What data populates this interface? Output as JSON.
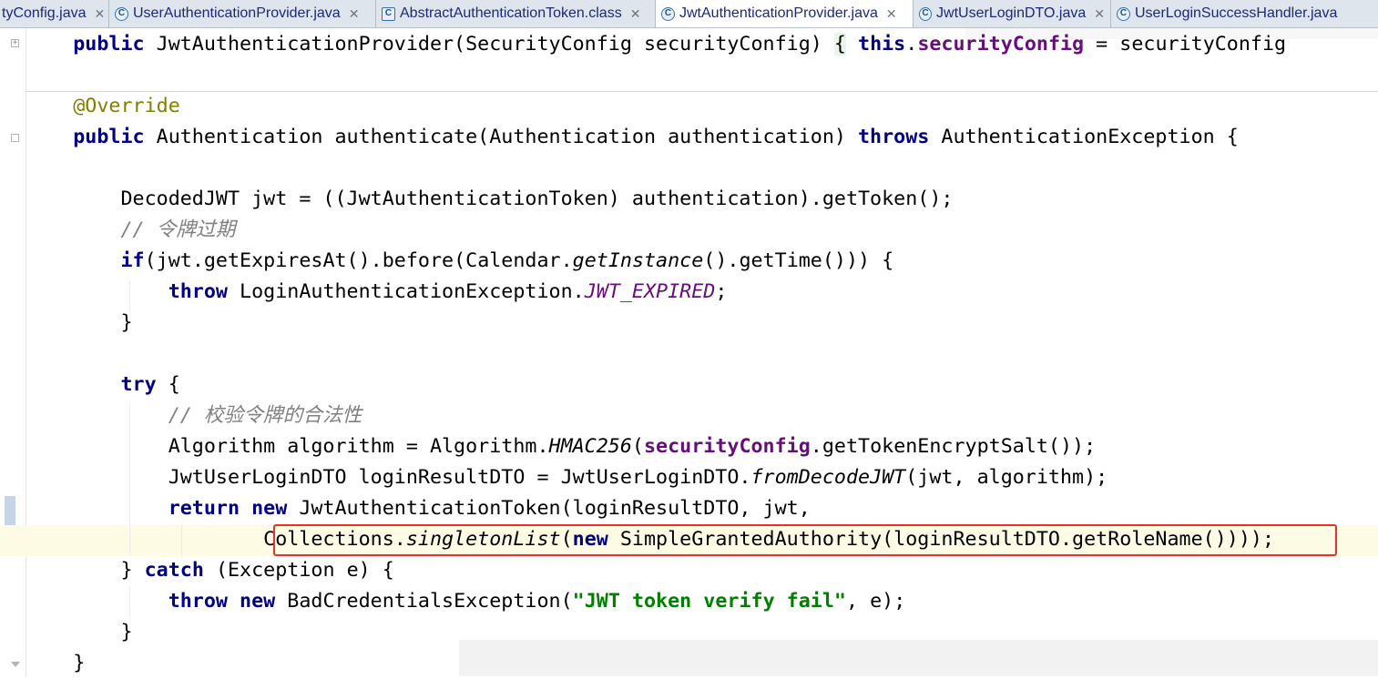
{
  "tabs": [
    {
      "label": "tyConfig.java",
      "icon": "class-file-icon",
      "active": false,
      "closable": true
    },
    {
      "label": "UserAuthenticationProvider.java",
      "icon": "class-file-icon",
      "active": false,
      "closable": true
    },
    {
      "label": "AbstractAuthenticationToken.class",
      "icon": "compiled-class-icon",
      "active": false,
      "closable": true
    },
    {
      "label": "JwtAuthenticationProvider.java",
      "icon": "class-file-icon",
      "active": true,
      "closable": true
    },
    {
      "label": "JwtUserLoginDTO.java",
      "icon": "class-file-icon",
      "active": false,
      "closable": true
    },
    {
      "label": "UserLoginSuccessHandler.java",
      "icon": "class-file-icon",
      "active": false,
      "closable": false
    }
  ],
  "code": {
    "l1": {
      "t1": "public",
      "t2": " JwtAuthenticationProvider(SecurityConfig securityConfig) ",
      "t3": "{",
      "t4": " ",
      "t5": "this",
      "t6": ".",
      "t7": "securityConfig",
      "t8": " = securityConfig"
    },
    "l2": {
      "t1": "@Override"
    },
    "l3": {
      "t1": "public",
      "t2": " Authentication authenticate(Authentication authentication) ",
      "t3": "throws",
      "t4": " AuthenticationException {"
    },
    "l4": {
      "t1": "DecodedJWT jwt = ((JwtAuthenticationToken) authentication).getToken();"
    },
    "l5": {
      "t1": "// 令牌过期"
    },
    "l6": {
      "t1": "if",
      "t2": "(jwt.getExpiresAt().before(Calendar.",
      "t3": "getInstance",
      "t4": "().getTime())) {"
    },
    "l7": {
      "t1": "throw",
      "t2": " LoginAuthenticationException.",
      "t3": "JWT_EXPIRED",
      "t4": ";"
    },
    "l8": {
      "t1": "}"
    },
    "l9": {
      "t1": "try",
      "t2": " {"
    },
    "l10": {
      "t1": "// 校验令牌的合法性"
    },
    "l11": {
      "t1": "Algorithm algorithm = Algorithm.",
      "t2": "HMAC256",
      "t3": "(",
      "t4": "securityConfig",
      "t5": ".getTokenEncryptSalt());"
    },
    "l12": {
      "t1": "JwtUserLoginDTO loginResultDTO = JwtUserLoginDTO.",
      "t2": "fromDecodeJWT",
      "t3": "(jwt, algorithm);"
    },
    "l13": {
      "t1": "return",
      "t2": " ",
      "t3": "new",
      "t4": " JwtAuthenticationToken(loginResultDTO, jwt,"
    },
    "l14": {
      "t1": "Collections.",
      "t2": "singletonList",
      "t3": "(",
      "t4": "new",
      "t5": " SimpleGrantedAuthority(loginResultDTO.getRoleName()))",
      "t6": ");"
    },
    "l15": {
      "t1": "} ",
      "t2": "catch",
      "t3": " (Exception e) {"
    },
    "l16": {
      "t1": "throw",
      "t2": " ",
      "t3": "new",
      "t4": " BadCredentialsException(",
      "t5": "\"JWT token verify fail\"",
      "t6": ", e);"
    },
    "l17": {
      "t1": "}"
    },
    "l18": {
      "t1": "}"
    }
  },
  "colors": {
    "keyword": "#000080",
    "annotation": "#808000",
    "comment": "#808080",
    "field": "#660e7a",
    "string": "#008000",
    "highlight_box": "#e8312a",
    "current_line": "#fdfbe4"
  }
}
